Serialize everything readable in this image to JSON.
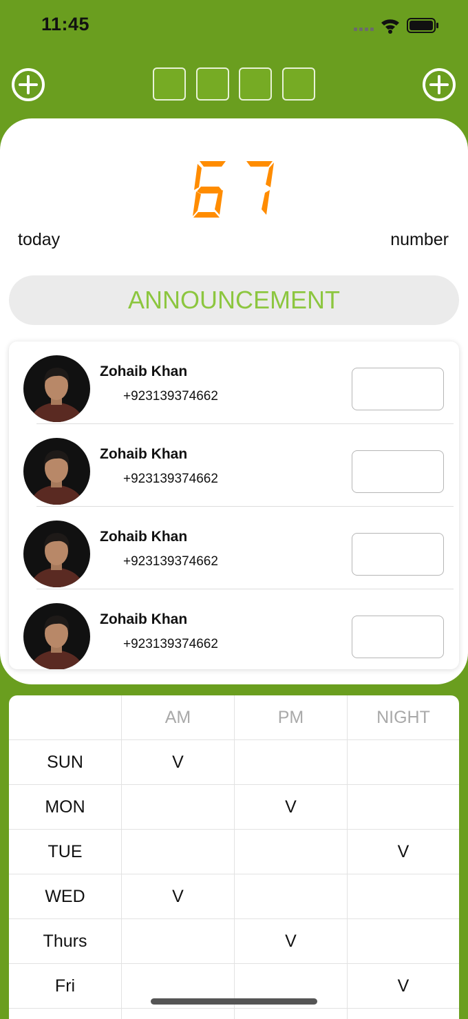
{
  "status_bar": {
    "time": "11:45"
  },
  "header": {
    "left_plus": "plus-circle-icon",
    "right_plus": "plus-circle-icon",
    "slot_count": 4,
    "accent": "#6a9e1f"
  },
  "counter": {
    "value": "67",
    "color": "#ff8c00"
  },
  "labels": {
    "left": "today",
    "right": "number"
  },
  "announcement": {
    "label": "ANNOUNCEMENT",
    "color": "#8cc63f"
  },
  "contacts": [
    {
      "name": "Zohaib Khan",
      "phone": "+923139374662"
    },
    {
      "name": "Zohaib Khan",
      "phone": "+923139374662"
    },
    {
      "name": "Zohaib Khan",
      "phone": "+923139374662"
    },
    {
      "name": "Zohaib Khan",
      "phone": "+923139374662"
    }
  ],
  "schedule": {
    "columns": [
      "",
      "AM",
      "PM",
      "NIGHT"
    ],
    "rows": [
      {
        "day": "SUN",
        "am": "V",
        "pm": "",
        "night": ""
      },
      {
        "day": "MON",
        "am": "",
        "pm": "V",
        "night": ""
      },
      {
        "day": "TUE",
        "am": "",
        "pm": "",
        "night": "V"
      },
      {
        "day": "WED",
        "am": "V",
        "pm": "",
        "night": ""
      },
      {
        "day": "Thurs",
        "am": "",
        "pm": "V",
        "night": ""
      },
      {
        "day": "Fri",
        "am": "",
        "pm": "",
        "night": "V"
      },
      {
        "day": "",
        "am": "",
        "pm": "",
        "night": ""
      }
    ]
  }
}
